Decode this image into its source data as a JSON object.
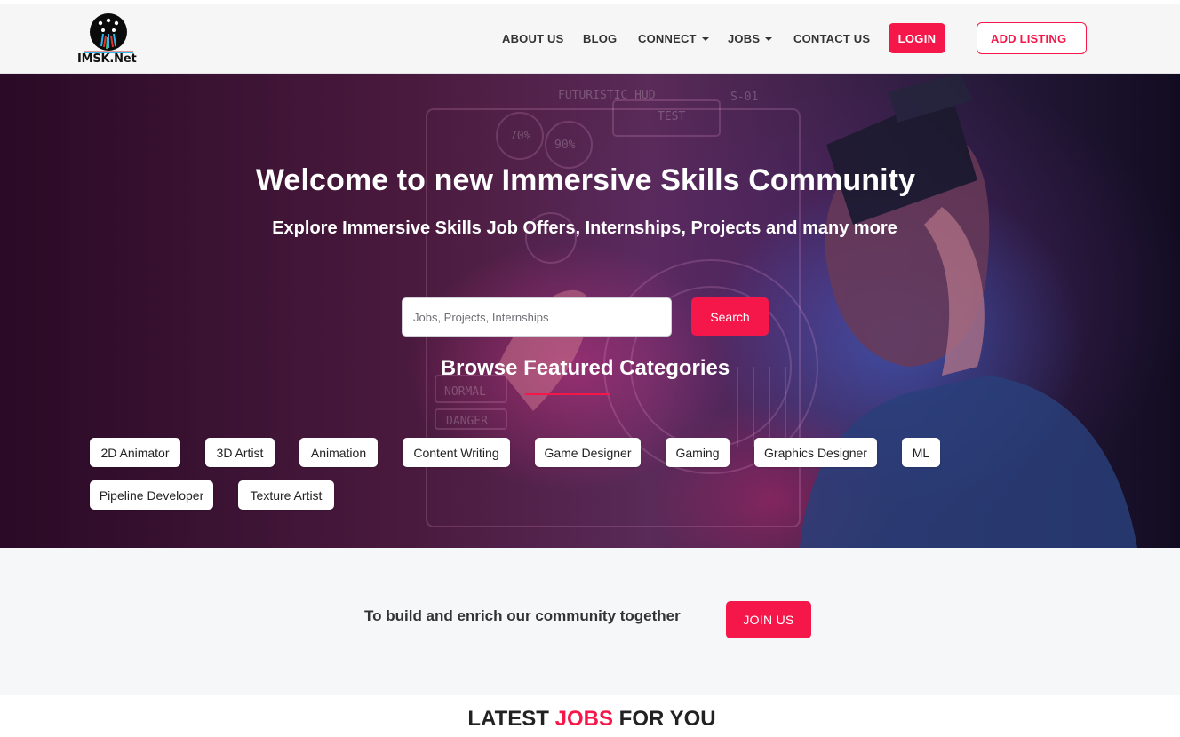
{
  "brand": {
    "name": "IMSK.Net",
    "colors": {
      "accent": "#f5174a",
      "header_bg": "#f6f6f7",
      "section_bg": "#f6f7f9"
    }
  },
  "nav": {
    "items": [
      {
        "label": "ABOUT US",
        "dropdown": false
      },
      {
        "label": "BLOG",
        "dropdown": false
      },
      {
        "label": "CONNECT",
        "dropdown": true
      },
      {
        "label": "JOBS",
        "dropdown": true
      },
      {
        "label": "CONTACT US",
        "dropdown": false
      }
    ],
    "login_label": "LOGIN",
    "add_listing_label": "ADD LISTING"
  },
  "hero": {
    "title": "Welcome to new Immersive Skills Community",
    "subtitle": "Explore Immersive Skills Job Offers, Internships, Projects and many more",
    "search_placeholder": "Jobs, Projects, Internships",
    "search_button": "Search",
    "categories_title": "Browse Featured Categories",
    "categories": [
      "2D Animator",
      "3D Artist",
      "Animation",
      "Content Writing",
      "Game Designer",
      "Gaming",
      "Graphics Designer",
      "ML",
      "Pipeline Developer",
      "Texture Artist"
    ],
    "background_texts": [
      "FUTURISTIC HUD",
      "TEST",
      "S-01",
      "70%",
      "90%",
      "NORMAL",
      "DANGER"
    ]
  },
  "join": {
    "text": "To build and enrich our community together",
    "button": "JOIN US"
  },
  "latest": {
    "prefix": "LATEST",
    "accent": "JOBS",
    "suffix": "FOR YOU"
  }
}
